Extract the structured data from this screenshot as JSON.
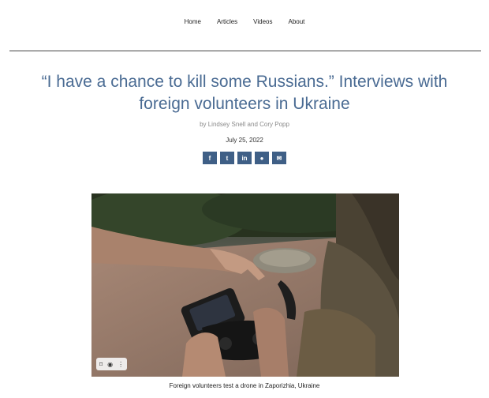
{
  "nav": {
    "items": [
      {
        "label": "Home"
      },
      {
        "label": "Articles"
      },
      {
        "label": "Videos"
      },
      {
        "label": "About"
      }
    ]
  },
  "article": {
    "title": "“I have a chance to kill some Russians.” Interviews with foreign volunteers in Ukraine",
    "byline": "by Lindsey Snell and Cory Popp",
    "date": "July 25, 2022",
    "caption": "Foreign volunteers test a drone in Zaporizhia, Ukraine"
  },
  "share": {
    "buttons": [
      {
        "icon": "facebook-icon",
        "glyph": "f"
      },
      {
        "icon": "twitter-icon",
        "glyph": "t"
      },
      {
        "icon": "linkedin-icon",
        "glyph": "in"
      },
      {
        "icon": "reddit-icon",
        "glyph": "●"
      },
      {
        "icon": "email-icon",
        "glyph": "✉"
      }
    ]
  },
  "photo_toolbar": {
    "icons": [
      "bookmark-icon",
      "camera-icon",
      "more-icon"
    ],
    "glyphs": [
      "⌑",
      "◉",
      "⋮"
    ]
  },
  "colors": {
    "title": "#4a6b93",
    "share_button": "#3f5f86"
  }
}
